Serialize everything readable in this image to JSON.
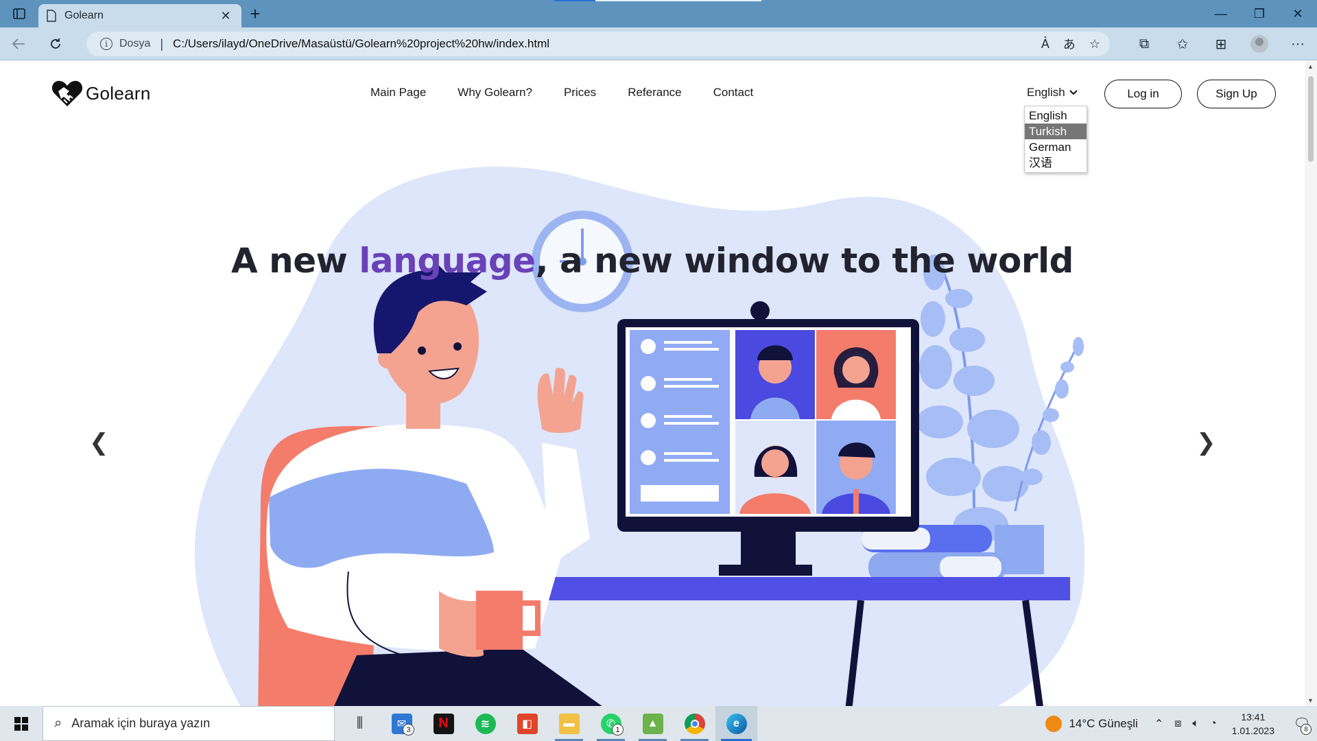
{
  "browser": {
    "tab_title": "Golearn",
    "tab_close": "✕",
    "new_tab": "+",
    "url_prefix": "Dosya",
    "url": "C:/Users/ilayd/OneDrive/Masaüstü/Golearn%20project%20hw/index.html",
    "window_controls": [
      "—",
      "❐",
      "✕"
    ]
  },
  "site": {
    "brand": "Golearn",
    "nav": [
      "Main Page",
      "Why Golearn?",
      "Prices",
      "Referance",
      "Contact"
    ],
    "language_selected": "English",
    "language_options": [
      "English",
      "Turkish",
      "German",
      "汉语"
    ],
    "language_highlighted": "Turkish",
    "login_label": "Log in",
    "signup_label": "Sign Up"
  },
  "hero": {
    "title_part1": "A new ",
    "title_accent": "language",
    "title_part2": ", a new window to the world",
    "accent_color": "#6a42b8",
    "prev_arrow": "❮",
    "next_arrow": "❯"
  },
  "taskbar": {
    "search_placeholder": "Aramak için buraya yazın",
    "mail_badge": "3",
    "whatsapp_badge": "1",
    "weather": "14°C  Güneşli",
    "time": "13:41",
    "date": "1.01.2023",
    "notifications": "8"
  }
}
